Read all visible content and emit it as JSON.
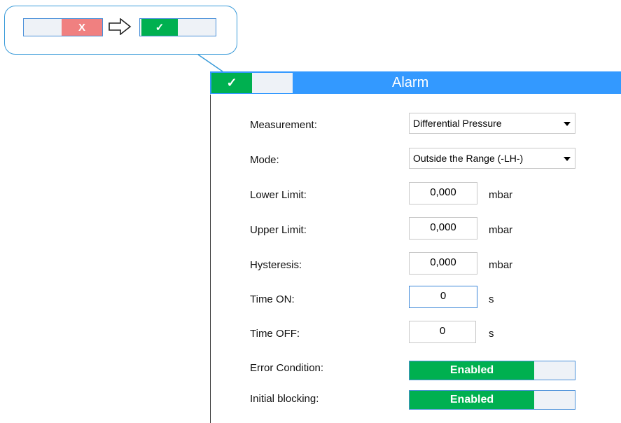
{
  "callout": {
    "before_toggle": {
      "off_label": "X"
    },
    "after_toggle": {
      "on_label": "✓"
    },
    "arrow_icon": "right-arrow-icon"
  },
  "panel": {
    "title": "Alarm",
    "title_toggle_label": "✓",
    "accent_color": "#3399ff",
    "on_color": "#00b050",
    "off_color": "#f08080"
  },
  "fields": {
    "measurement": {
      "label": "Measurement:",
      "value": "Differential Pressure"
    },
    "mode": {
      "label": "Mode:",
      "value": "Outside the Range (-LH-)"
    },
    "lower_limit": {
      "label": "Lower Limit:",
      "value": "0,000",
      "unit": "mbar"
    },
    "upper_limit": {
      "label": "Upper Limit:",
      "value": "0,000",
      "unit": "mbar"
    },
    "hysteresis": {
      "label": "Hysteresis:",
      "value": "0,000",
      "unit": "mbar"
    },
    "time_on": {
      "label": "Time ON:",
      "value": "0",
      "unit": "s"
    },
    "time_off": {
      "label": "Time OFF:",
      "value": "0",
      "unit": "s"
    },
    "error_condition": {
      "label": "Error Condition:",
      "value": "Enabled"
    },
    "initial_blocking": {
      "label": "Initial blocking:",
      "value": "Enabled"
    }
  }
}
